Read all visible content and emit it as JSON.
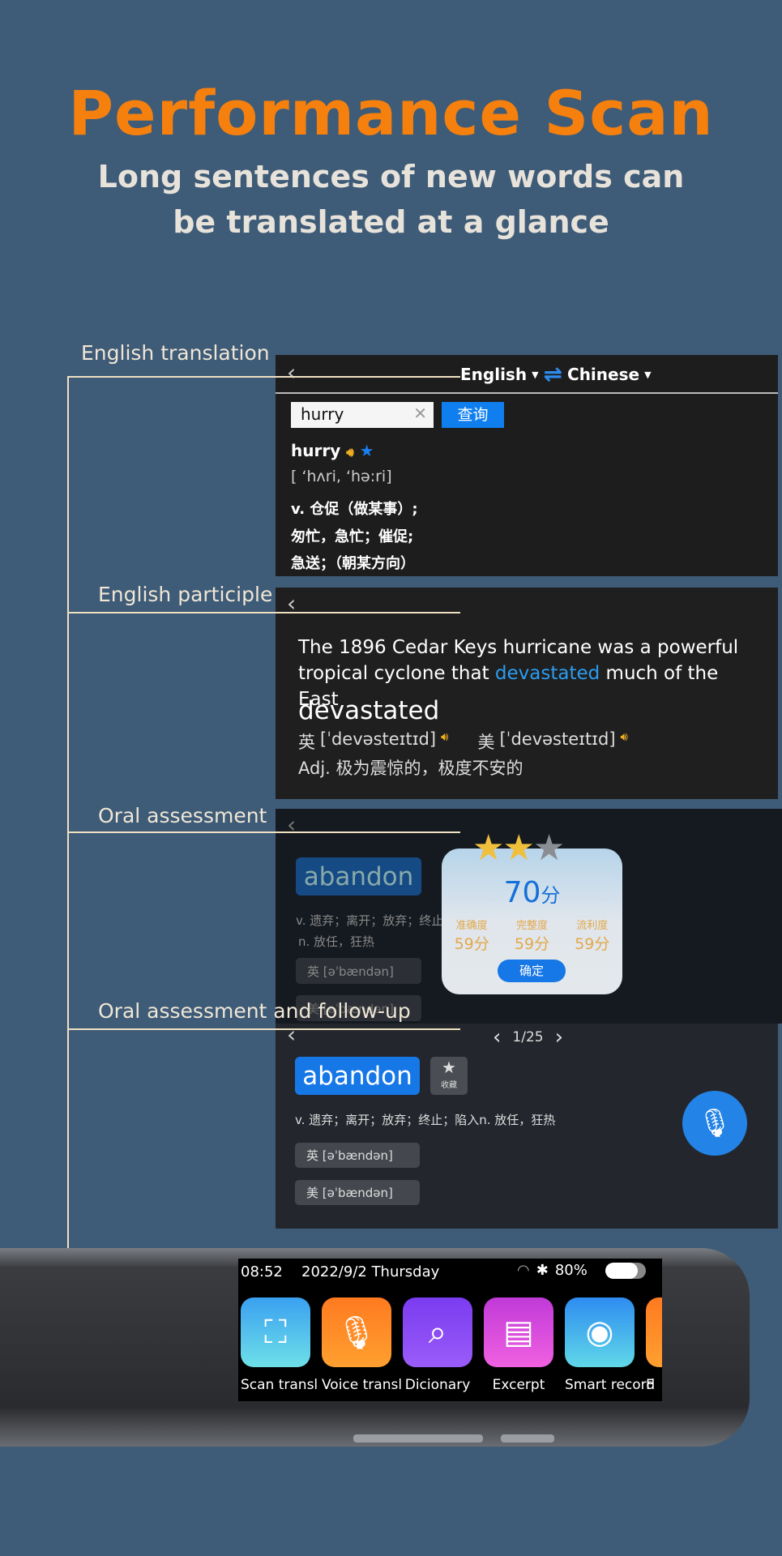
{
  "header": {
    "title": "Performance Scan",
    "subtitle_line1": "Long sentences of new words can",
    "subtitle_line2": "be translated at a glance"
  },
  "labels": [
    "English translation",
    "English participle",
    "Oral assessment",
    "Oral assessment and follow-up"
  ],
  "translation": {
    "source_lang": "English",
    "target_lang": "Chinese",
    "input_value": "hurry",
    "query_button": "查询",
    "word": "hurry",
    "phonetic": "[ ‘hʌri, ‘hə:ri]",
    "definitions": [
      "v. 仓促（做某事）;",
      "匆忙，急忙；催促;",
      "急送；（朝某方向）"
    ]
  },
  "participle": {
    "sentence_pre": "The 1896 Cedar Keys hurricane was a powerful tropical cyclone that ",
    "highlight": "devastated",
    "sentence_post": " much of the East",
    "word": "devastated",
    "uk_label": "英",
    "uk_phonetic": "[ˈdevəsteɪtɪd]",
    "us_label": "美",
    "us_phonetic": "[ˈdevəsteɪtɪd]",
    "definition": "Adj. 极为震惊的，极度不安的"
  },
  "assessment": {
    "word": "abandon",
    "def1": "v. 遗弃；离开；放弃；终止",
    "def2": "n. 放任，狂热",
    "uk": "英 [əˈbændən]",
    "us": "美 [əˈbændən]",
    "stars": 2,
    "max_stars": 3,
    "score": "70",
    "score_unit": "分",
    "metrics": [
      {
        "label": "准确度",
        "value": "59分"
      },
      {
        "label": "完整度",
        "value": "59分"
      },
      {
        "label": "流利度",
        "value": "59分"
      }
    ],
    "confirm": "确定"
  },
  "followup": {
    "page": "1/25",
    "word": "abandon",
    "favorite": "收藏",
    "definition": "v. 遗弃；离开；放弃；终止；陷入n. 放任，狂热",
    "uk": "英 [əˈbændən]",
    "us": "美 [əˈbændən]"
  },
  "device": {
    "time": "08:52",
    "date": "2022/9/2 Thursday",
    "battery": "80%",
    "battery_level": 80,
    "apps": [
      {
        "label": "Scan transl",
        "icon": "scan-icon"
      },
      {
        "label": "Voice transl",
        "icon": "microphone-icon"
      },
      {
        "label": "Dicionary",
        "icon": "search-icon"
      },
      {
        "label": "Excerpt",
        "icon": "document-icon"
      },
      {
        "label": "Smart record",
        "icon": "waveform-icon"
      },
      {
        "label": "F",
        "icon": "app-icon"
      }
    ]
  },
  "colors": {
    "accent": "#f5800e",
    "blue": "#1677e6",
    "star": "#f0bf3c"
  }
}
